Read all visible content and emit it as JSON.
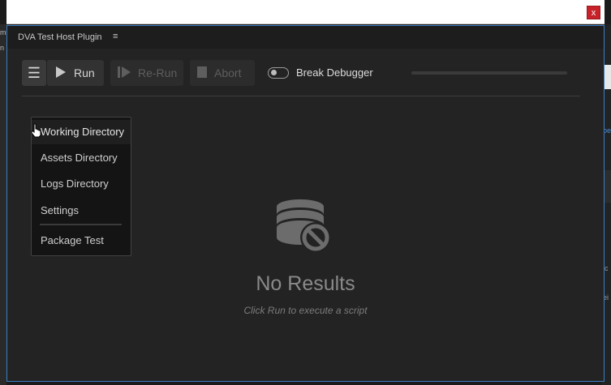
{
  "close_label": "x",
  "dialog": {
    "title": "DVA Test Host Plugin",
    "title_menu_glyph": "≡"
  },
  "toolbar": {
    "menu_glyph": "☰",
    "run_label": "Run",
    "rerun_label": "Re-Run",
    "abort_label": "Abort",
    "toggle_label": "Break Debugger",
    "progress_fraction": 0
  },
  "dropdown": {
    "items": [
      "Working Directory",
      "Assets Directory",
      "Logs Directory",
      "Settings",
      "Package Test"
    ],
    "active_index": 0
  },
  "empty_state": {
    "title": "No Results",
    "subtitle": "Click Run to execute a script",
    "icon": "database-blocked-icon"
  },
  "icons": {
    "run": "play-icon",
    "rerun": "rerun-icon",
    "abort": "stop-icon",
    "menu": "hamburger-icon"
  },
  "colors": {
    "accent_border": "#3c7ec7",
    "close_button": "#c7222a",
    "panel_bg": "#232323"
  },
  "background": {
    "left_text": [
      "m",
      "n"
    ],
    "right_text": [
      "pe",
      "ic",
      "ei"
    ]
  }
}
